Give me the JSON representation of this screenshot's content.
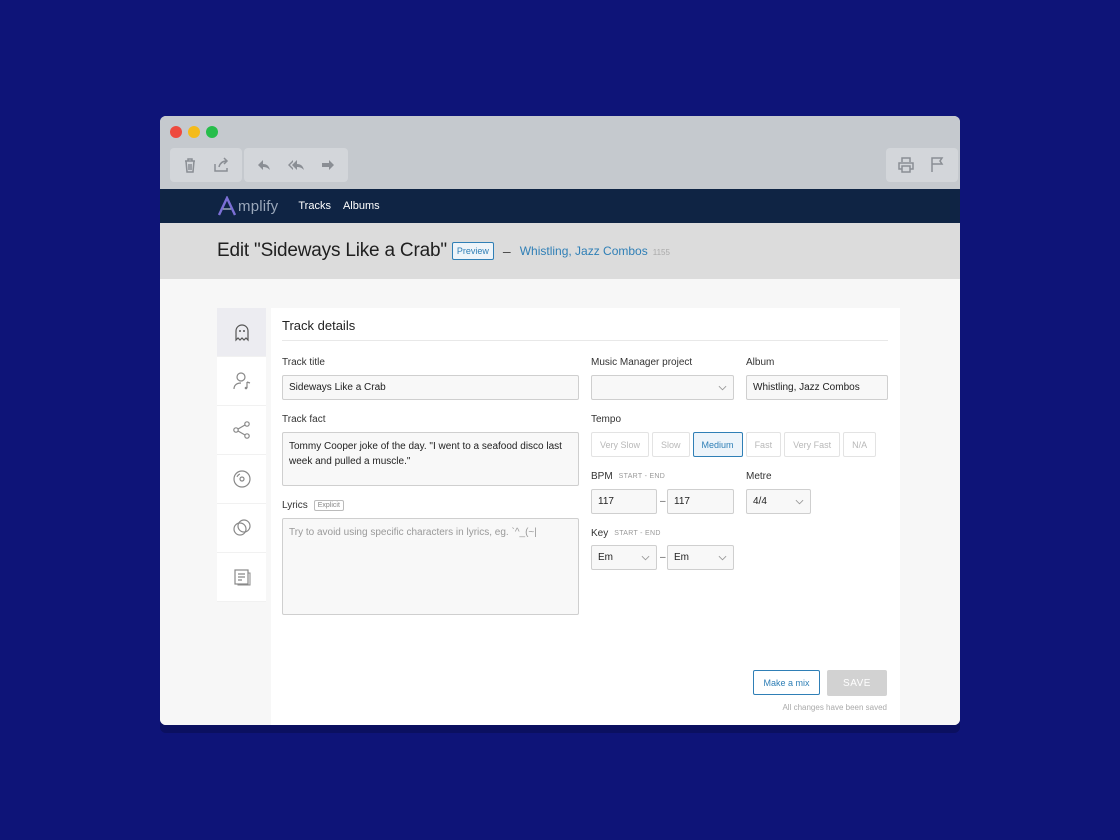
{
  "brand": {
    "logo_text": "mplify",
    "accent": "#2f7fb6",
    "nav_bg": "#0f2444"
  },
  "toolbar": {
    "left_icons": [
      "trash-icon",
      "share-icon"
    ],
    "middle_icons": [
      "reply-icon",
      "reply-all-icon",
      "forward-icon"
    ],
    "right_icons": [
      "print-icon",
      "flag-icon"
    ]
  },
  "nav": {
    "tracks": "Tracks",
    "albums": "Albums"
  },
  "header": {
    "title": "Edit \"Sideways Like a Crab\"",
    "preview": "Preview",
    "dash": "–",
    "album_link": "Whistling, Jazz Combos",
    "album_number": "1155"
  },
  "sidebar_icons": [
    "ghost-icon",
    "person-music-icon",
    "share-nodes-icon",
    "vinyl-icon",
    "circles-icon",
    "document-icon"
  ],
  "form": {
    "section_title": "Track details",
    "track_title_label": "Track title",
    "track_title_value": "Sideways Like a Crab",
    "track_fact_label": "Track fact",
    "track_fact_value": "Tommy Cooper joke of the day. \"I went to a seafood disco last week and pulled a muscle.\"",
    "lyrics_label": "Lyrics",
    "lyrics_badge": "Explicit",
    "lyrics_placeholder": "Try to avoid using specific characters in lyrics, eg. `^_(~|",
    "project_label": "Music Manager project",
    "project_value": "",
    "album_label": "Album",
    "album_value": "Whistling, Jazz Combos",
    "tempo_label": "Tempo",
    "tempo_options": [
      "Very Slow",
      "Slow",
      "Medium",
      "Fast",
      "Very Fast",
      "N/A"
    ],
    "tempo_selected": "Medium",
    "bpm_label": "BPM",
    "bpm_sub": "START - END",
    "bpm_start": "117",
    "bpm_end": "117",
    "range_sep": "–",
    "metre_label": "Metre",
    "metre_value": "4/4",
    "key_label": "Key",
    "key_sub": "START - END",
    "key_start": "Em",
    "key_end": "Em"
  },
  "actions": {
    "mix": "Make a mix",
    "save": "SAVE",
    "status": "All changes have been saved"
  }
}
